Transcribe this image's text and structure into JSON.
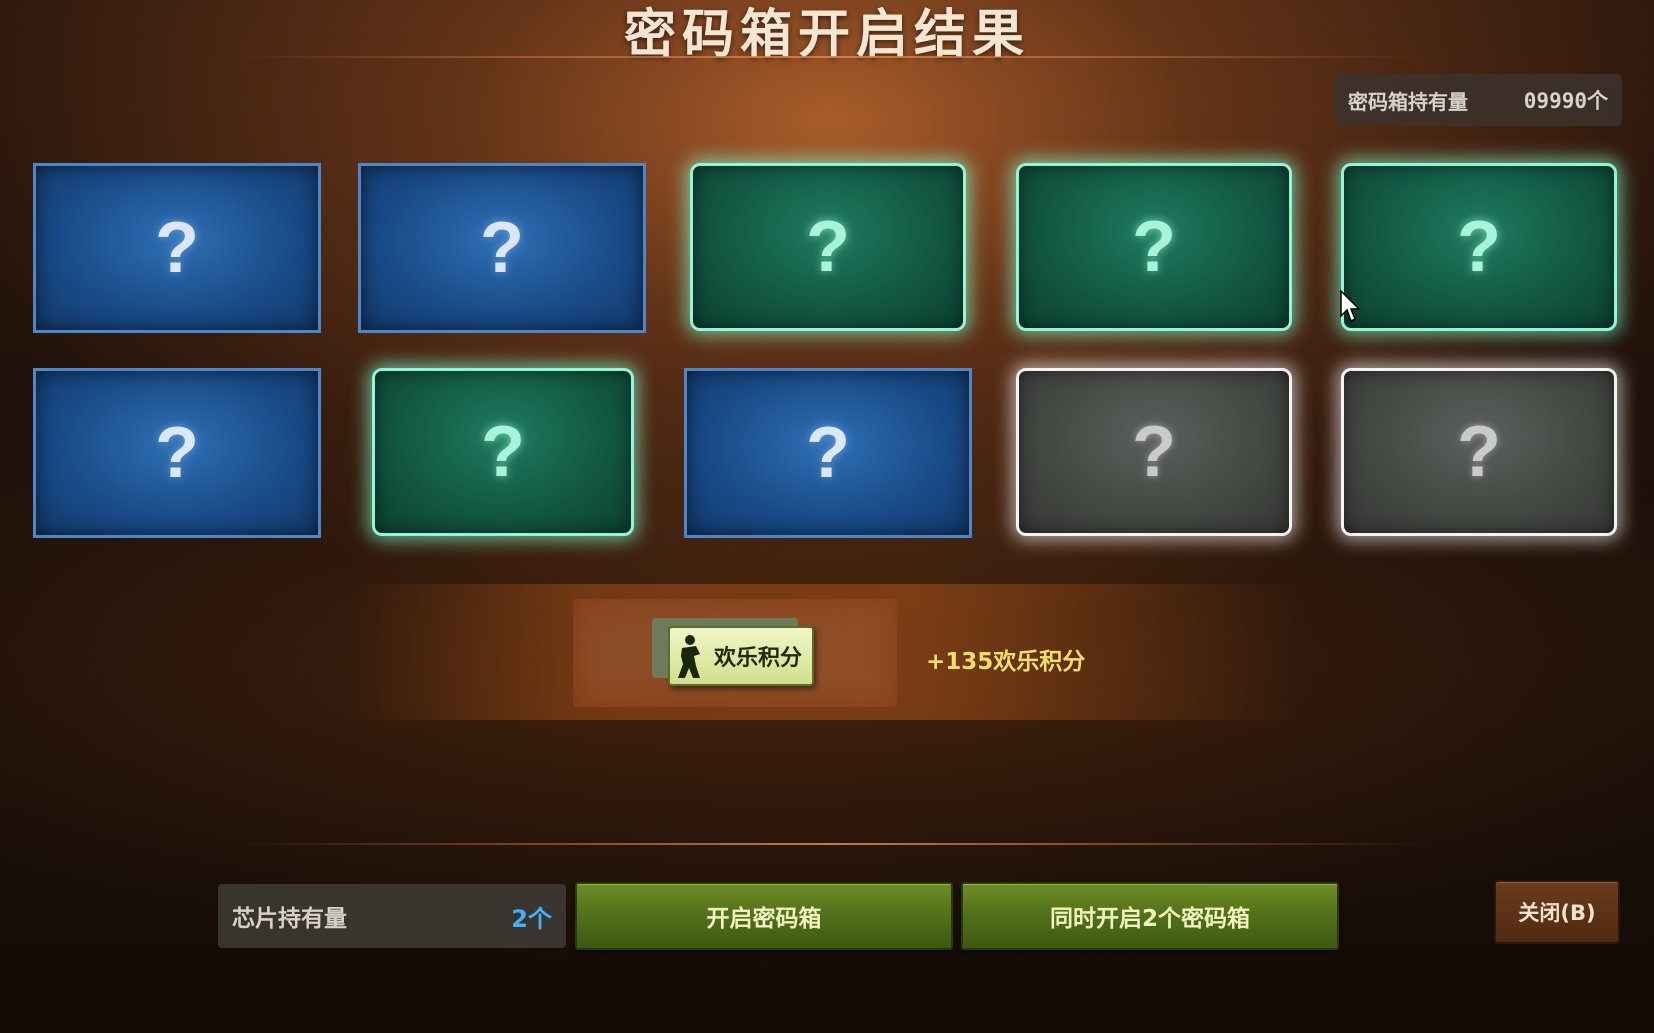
{
  "title": "密码箱开启结果",
  "box_stock": {
    "label": "密码箱持有量",
    "value": "09990个"
  },
  "cards": [
    {
      "state": "blue",
      "symbol": "?"
    },
    {
      "state": "blue",
      "symbol": "?"
    },
    {
      "state": "green",
      "symbol": "?"
    },
    {
      "state": "green",
      "symbol": "?"
    },
    {
      "state": "green",
      "symbol": "?"
    },
    {
      "state": "blue",
      "symbol": "?"
    },
    {
      "state": "green",
      "symbol": "?"
    },
    {
      "state": "blue",
      "symbol": "?"
    },
    {
      "state": "gray",
      "symbol": "?"
    },
    {
      "state": "gray",
      "symbol": "?"
    }
  ],
  "reward": {
    "ticket_label": "欢乐积分",
    "text": "+135欢乐积分",
    "icon": "soldier-silhouette-icon"
  },
  "chip_stock": {
    "label": "芯片持有量",
    "value": "2个"
  },
  "buttons": {
    "open_box": "开启密码箱",
    "open_two": "同时开启2个密码箱",
    "close": "关闭(B)"
  },
  "colors": {
    "accent_green": "#50701a",
    "card_blue": "#1a4d8b",
    "card_green": "#135944",
    "card_gray": "#454944",
    "reward_text": "#f3e06c",
    "chip_value": "#3fb2ff"
  }
}
